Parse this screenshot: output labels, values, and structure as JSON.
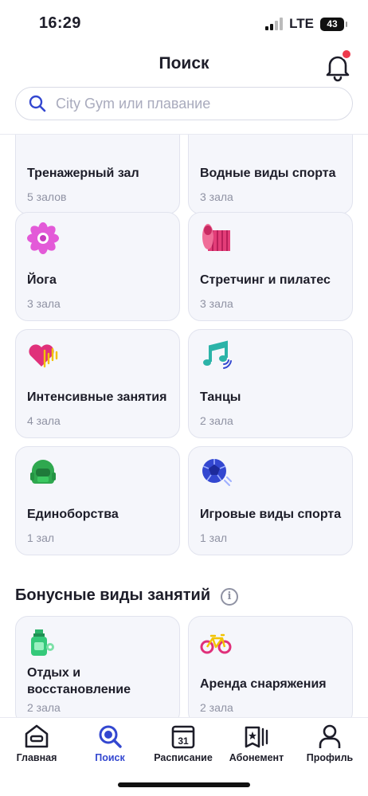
{
  "status_bar": {
    "time": "16:29",
    "network": "LTE",
    "battery": "43"
  },
  "header": {
    "title": "Поиск",
    "notifications_icon": "bell-icon",
    "has_unread": true
  },
  "search": {
    "placeholder": "City Gym или плавание",
    "value": ""
  },
  "categories": [
    {
      "title": "Тренажерный зал",
      "count": "5 залов",
      "icon": "gym-icon"
    },
    {
      "title": "Водные виды спорта",
      "count": "3 зала",
      "icon": "water-icon"
    },
    {
      "title": "Йога",
      "count": "3 зала",
      "icon": "lotus-icon"
    },
    {
      "title": "Стретчинг и пилатес",
      "count": "3 зала",
      "icon": "yoga-mat-icon"
    },
    {
      "title": "Интенсивные занятия",
      "count": "4 зала",
      "icon": "heart-pulse-icon"
    },
    {
      "title": "Танцы",
      "count": "2 зала",
      "icon": "music-note-icon"
    },
    {
      "title": "Единоборства",
      "count": "1 зал",
      "icon": "boxing-helmet-icon"
    },
    {
      "title": "Игровые виды спорта",
      "count": "1 зал",
      "icon": "ball-icon"
    }
  ],
  "bonus_section": {
    "title": "Бонусные виды занятий",
    "info_icon": "info-icon",
    "items": [
      {
        "title": "Отдых и восстановление",
        "count": "2 зала",
        "icon": "spa-bottle-icon"
      },
      {
        "title": "Аренда снаряжения",
        "count": "2 зала",
        "icon": "bicycle-icon"
      }
    ]
  },
  "tabs": [
    {
      "label": "Главная",
      "icon": "home-icon",
      "active": false
    },
    {
      "label": "Поиск",
      "icon": "search-icon",
      "active": true
    },
    {
      "label": "Расписание",
      "icon": "calendar-icon",
      "calendar_day": "31",
      "active": false
    },
    {
      "label": "Абонемент",
      "icon": "membership-card-icon",
      "active": false
    },
    {
      "label": "Профиль",
      "icon": "profile-icon",
      "active": false
    }
  ],
  "colors": {
    "accent": "#3347d0",
    "text": "#1d1d29",
    "muted": "#8f92a3",
    "card_bg": "#f5f6fb",
    "badge": "#ee3a4c"
  }
}
